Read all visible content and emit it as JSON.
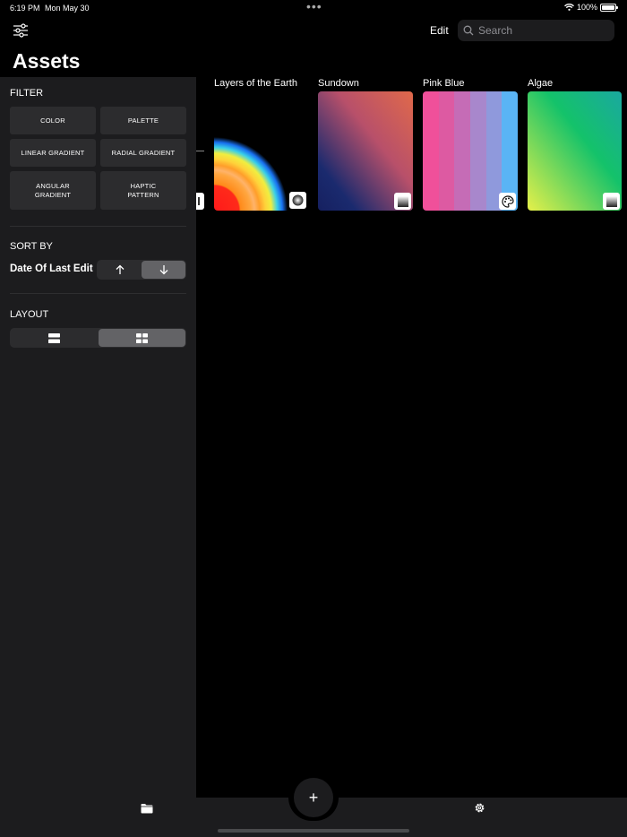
{
  "status": {
    "time": "6:19 PM",
    "date": "Mon May 30",
    "battery": "100%"
  },
  "header": {
    "edit_label": "Edit",
    "search_placeholder": "Search",
    "title": "Assets"
  },
  "sidebar": {
    "filter_label": "FILTER",
    "filters": [
      {
        "label": "COLOR"
      },
      {
        "label": "PALETTE"
      },
      {
        "label": "LINEAR GRADIENT"
      },
      {
        "label": "RADIAL GRADIENT"
      },
      {
        "label": "ANGULAR\nGRADIENT"
      },
      {
        "label": "HAPTIC\nPATTERN"
      }
    ],
    "sort_label": "SORT BY",
    "sort_field": "Date Of Last Edit",
    "sort_options": [
      "ascending-arrow-icon",
      "descending-arrow-icon"
    ],
    "sort_selected": "descending",
    "layout_label": "LAYOUT",
    "layout_options": [
      "list-layout-icon",
      "grid-layout-icon"
    ],
    "layout_selected": "grid"
  },
  "assets": [
    {
      "title": "Layers of the Earth",
      "type_icon": "radial-gradient-icon"
    },
    {
      "title": "Sundown",
      "type_icon": "linear-gradient-icon",
      "colors": [
        "#e0694a",
        "#1a2a6e"
      ]
    },
    {
      "title": "Pink Blue",
      "type_icon": "palette-icon",
      "colors": [
        "#f0509a",
        "#dd5aa2",
        "#c56cb6",
        "#a887cc",
        "#8f99dc",
        "#5ab4f5"
      ]
    },
    {
      "title": "Algae",
      "type_icon": "linear-gradient-icon",
      "colors": [
        "#1aa8a0",
        "#14c26a",
        "#e6f04a"
      ]
    }
  ],
  "tabbar": {
    "add_label": "+",
    "left_icon": "folder-icon",
    "right_icon": "gear-icon"
  }
}
